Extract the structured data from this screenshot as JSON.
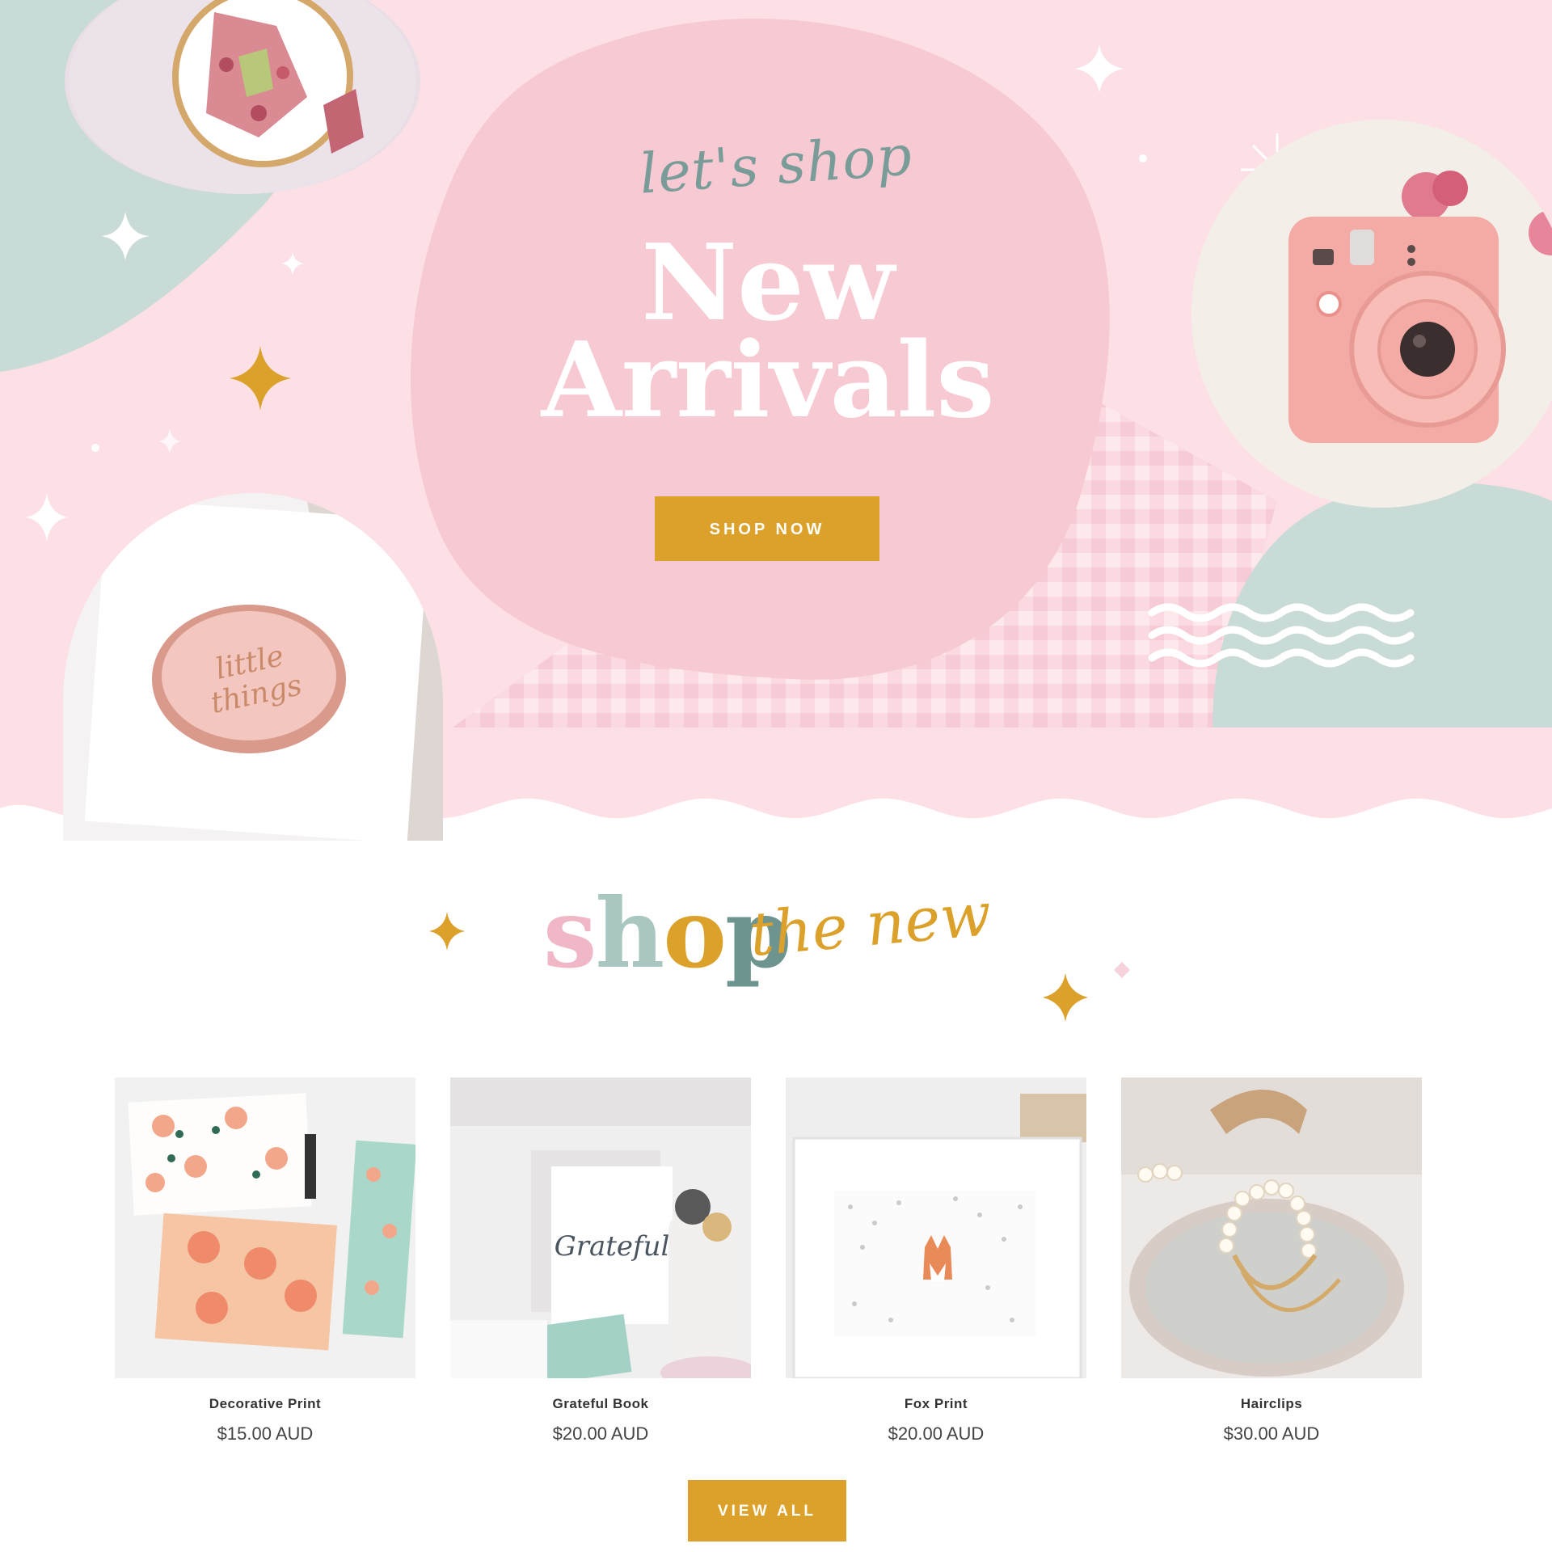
{
  "colors": {
    "hero_pink": "#fce0e6",
    "blob_pink": "#f6c9d3",
    "sage": "#c8dbd7",
    "gold": "#dba12a",
    "white": "#ffffff"
  },
  "hero": {
    "script_text": "let's shop",
    "title_line1": "New",
    "title_line2": "Arrivals",
    "cta_label": "SHOP NOW"
  },
  "section": {
    "title_part1": "shop",
    "title_letters": [
      {
        "char": "s",
        "color": "#f0b8c6"
      },
      {
        "char": "h",
        "color": "#a9c7c0"
      },
      {
        "char": "o",
        "color": "#dba12a"
      },
      {
        "char": "p",
        "color": "#6e9490"
      }
    ],
    "title_part2": "the new"
  },
  "products": [
    {
      "name": "Decorative Print",
      "price": "$15.00 AUD",
      "image_icon": "floral-cards-icon"
    },
    {
      "name": "Grateful Book",
      "price": "$20.00 AUD",
      "image_icon": "grateful-book-icon"
    },
    {
      "name": "Fox Print",
      "price": "$20.00 AUD",
      "image_icon": "fox-print-icon"
    },
    {
      "name": "Hairclips",
      "price": "$30.00 AUD",
      "image_icon": "pearl-hairclip-icon"
    }
  ],
  "view_all_label": "VIEW ALL",
  "photos": {
    "top_left": "cake-slice-photo",
    "bottom_left": "trinket-dish-photo",
    "right": "instant-camera-photo",
    "dish_script": "little things"
  }
}
